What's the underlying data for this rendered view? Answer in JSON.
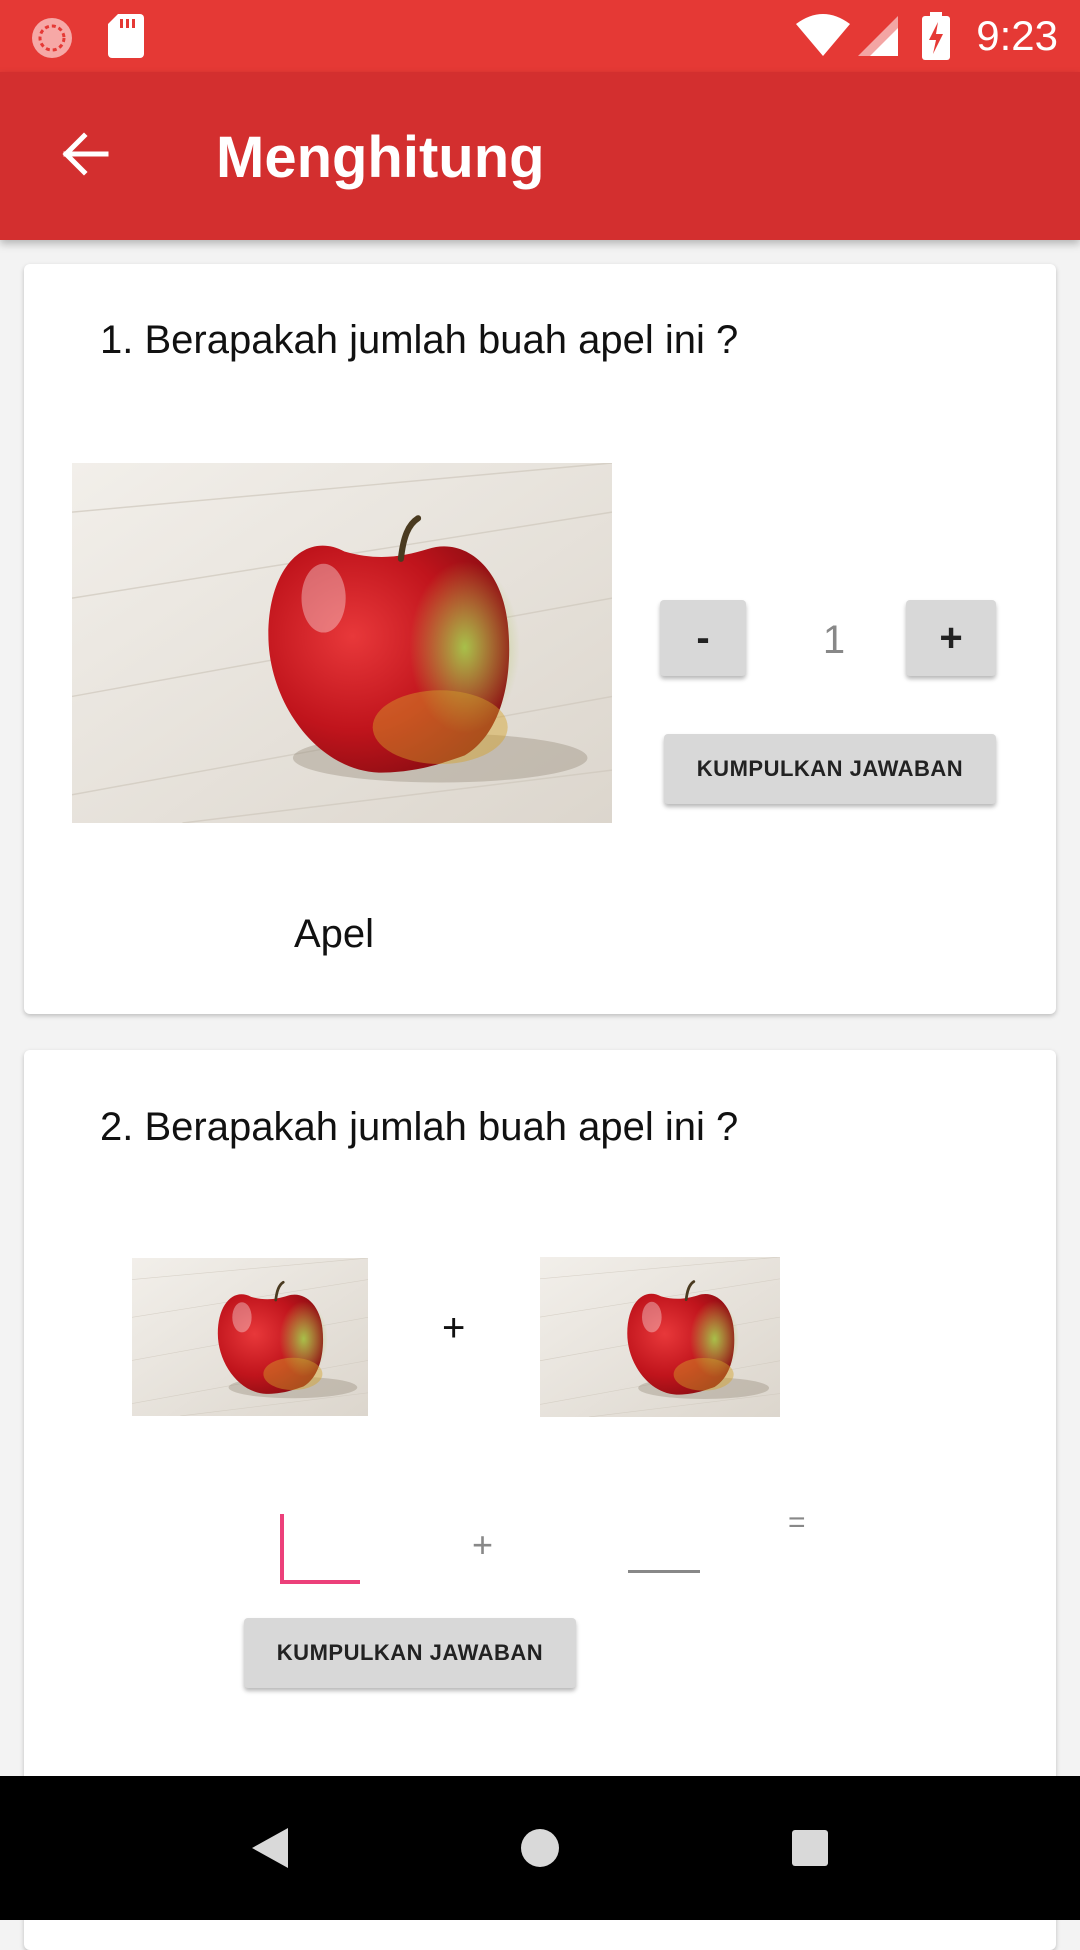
{
  "status_bar": {
    "time": "9:23",
    "icons": [
      "record-icon",
      "sd-card-icon",
      "wifi-icon",
      "signal-icon",
      "battery-charging-icon"
    ]
  },
  "toolbar": {
    "title": "Menghitung",
    "back_icon": "arrow-back-icon"
  },
  "colors": {
    "status_bar": "#e53935",
    "toolbar": "#d32f2f",
    "accent": "#ec407a"
  },
  "question1": {
    "text": "1. Berapakah jumlah buah apel ini ?",
    "count": "1",
    "minus_label": "-",
    "plus_label": "+",
    "submit_label": "KUMPULKAN JAWABAN",
    "image_caption": "Apel"
  },
  "question2": {
    "text": "2. Berapakah jumlah buah apel ini ?",
    "operator": "+",
    "input1_value": "",
    "input_operator": "+",
    "input2_value": "",
    "equals": "=",
    "submit_label": "KUMPULKAN JAWABAN"
  },
  "nav_bar": {
    "icons": [
      "back-triangle-icon",
      "home-circle-icon",
      "recents-square-icon"
    ]
  }
}
